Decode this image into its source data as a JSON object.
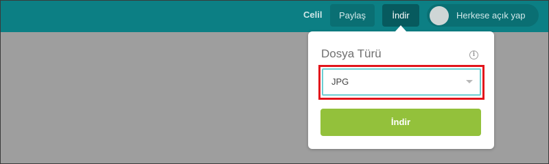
{
  "topbar": {
    "user_name": "Celil",
    "share_label": "Paylaş",
    "download_label": "İndir",
    "public_toggle_label": "Herkese açık yap",
    "public_toggle_on": false
  },
  "download_popup": {
    "title": "Dosya Türü",
    "info_icon": "i",
    "file_type": {
      "selected": "JPG"
    },
    "download_label": "İndir"
  },
  "colors": {
    "topbar": "#0c7f84",
    "background_overlay": "#9e9e9e",
    "download_button": "#93c13b",
    "select_border": "#6ccfd3",
    "highlight": "#e2141b"
  },
  "icons": [
    "info-icon",
    "chevron-down-icon",
    "toggle-knob"
  ]
}
